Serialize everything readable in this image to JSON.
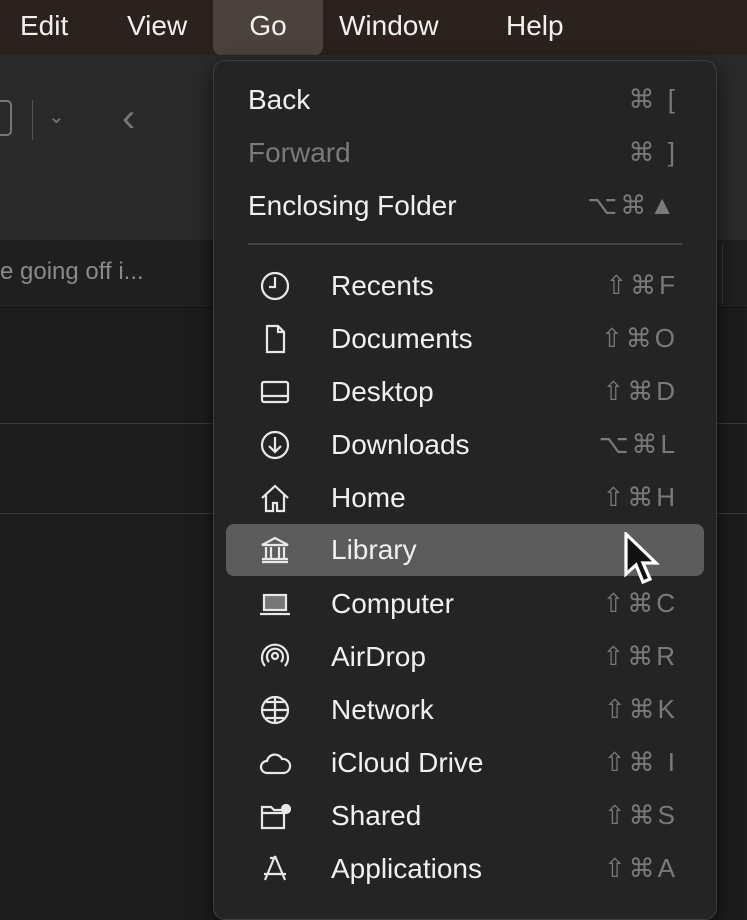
{
  "menubar": {
    "items": [
      "Edit",
      "View",
      "Go",
      "Window",
      "Help"
    ],
    "active": "Go"
  },
  "window": {
    "truncated_text": "e going off i..."
  },
  "go_menu": {
    "top_items": [
      {
        "label": "Back",
        "shortcut": "⌘ [",
        "enabled": true
      },
      {
        "label": "Forward",
        "shortcut": "⌘ ]",
        "enabled": false
      },
      {
        "label": "Enclosing Folder",
        "shortcut": "⌥⌘▲",
        "enabled": true
      }
    ],
    "locations": [
      {
        "label": "Recents",
        "shortcut": "⇧⌘F",
        "icon": "clock-icon"
      },
      {
        "label": "Documents",
        "shortcut": "⇧⌘O",
        "icon": "document-icon"
      },
      {
        "label": "Desktop",
        "shortcut": "⇧⌘D",
        "icon": "desktop-icon"
      },
      {
        "label": "Downloads",
        "shortcut": "⌥⌘L",
        "icon": "download-icon"
      },
      {
        "label": "Home",
        "shortcut": "⇧⌘H",
        "icon": "home-icon"
      },
      {
        "label": "Library",
        "shortcut": "",
        "icon": "library-icon",
        "highlighted": true
      },
      {
        "label": "Computer",
        "shortcut": "⇧⌘C",
        "icon": "laptop-icon"
      },
      {
        "label": "AirDrop",
        "shortcut": "⇧⌘R",
        "icon": "airdrop-icon"
      },
      {
        "label": "Network",
        "shortcut": "⇧⌘K",
        "icon": "globe-icon"
      },
      {
        "label": "iCloud Drive",
        "shortcut": "⇧⌘ I",
        "icon": "cloud-icon"
      },
      {
        "label": "Shared",
        "shortcut": "⇧⌘S",
        "icon": "shared-folder-icon"
      },
      {
        "label": "Applications",
        "shortcut": "⇧⌘A",
        "icon": "applications-icon"
      }
    ]
  }
}
